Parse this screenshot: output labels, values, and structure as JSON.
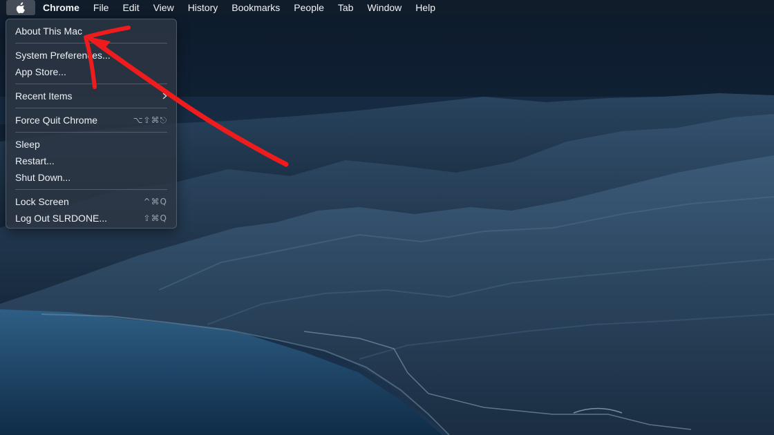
{
  "menubar": {
    "apple_icon": "apple-icon",
    "items": [
      {
        "label": "Chrome"
      },
      {
        "label": "File"
      },
      {
        "label": "Edit"
      },
      {
        "label": "View"
      },
      {
        "label": "History"
      },
      {
        "label": "Bookmarks"
      },
      {
        "label": "People"
      },
      {
        "label": "Tab"
      },
      {
        "label": "Window"
      },
      {
        "label": "Help"
      }
    ]
  },
  "apple_menu": {
    "about": {
      "label": "About This Mac"
    },
    "system_prefs": {
      "label": "System Preferences..."
    },
    "app_store": {
      "label": "App Store..."
    },
    "recent_items": {
      "label": "Recent Items",
      "submenu_icon": "chevron-right-icon"
    },
    "force_quit": {
      "label": "Force Quit Chrome",
      "shortcut": "⌥⇧⌘⎋"
    },
    "sleep": {
      "label": "Sleep"
    },
    "restart": {
      "label": "Restart..."
    },
    "shut_down": {
      "label": "Shut Down..."
    },
    "lock_screen": {
      "label": "Lock Screen",
      "shortcut": "^⌘Q"
    },
    "log_out": {
      "label": "Log Out SLRDONE...",
      "shortcut": "⇧⌘Q"
    }
  },
  "annotation": {
    "color": "#ee1c1c",
    "icon": "red-arrow-annotation"
  },
  "theme": {
    "menubar_bg": "#121c2a",
    "menu_bg": "#2c3644",
    "text": "#eef1f5"
  }
}
